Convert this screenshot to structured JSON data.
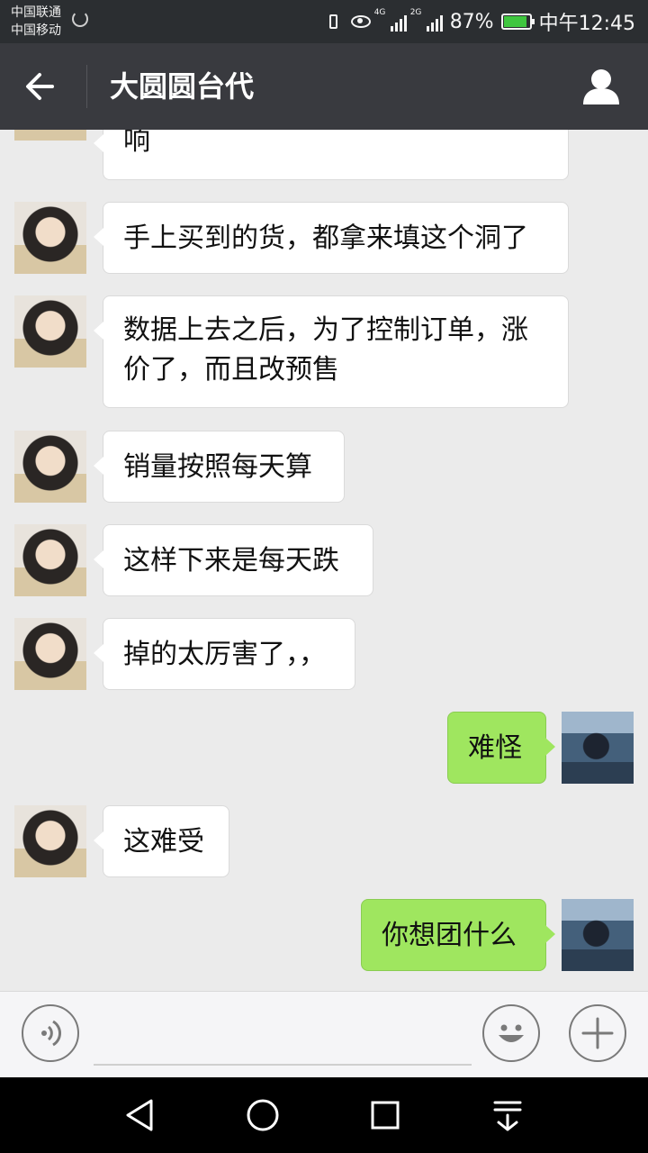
{
  "status_bar": {
    "carrier_1": "中国联通",
    "carrier_2": "中国移动",
    "net_1": "4G",
    "net_2": "2G",
    "battery": "87%",
    "time": "中午12:45",
    "battery_color": "#3fc63f"
  },
  "header": {
    "title": "大圆圆台代"
  },
  "messages": [
    {
      "side": "left",
      "text": "响"
    },
    {
      "side": "left",
      "text": "手上买到的货，都拿来填这个洞了"
    },
    {
      "side": "left",
      "text": "数据上去之后，为了控制订单，涨价了，而且改预售"
    },
    {
      "side": "left",
      "text": "销量按照每天算"
    },
    {
      "side": "left",
      "text": "这样下来是每天跌"
    },
    {
      "side": "left",
      "text": "掉的太厉害了，，"
    },
    {
      "side": "right",
      "text": "难怪"
    },
    {
      "side": "left",
      "text": "这难受"
    },
    {
      "side": "right",
      "text": "你想团什么"
    }
  ],
  "input_bar": {
    "placeholder": ""
  },
  "colors": {
    "sent_bubble": "#9fe65f",
    "received_bubble": "#ffffff",
    "header_bg": "#393a3f"
  }
}
